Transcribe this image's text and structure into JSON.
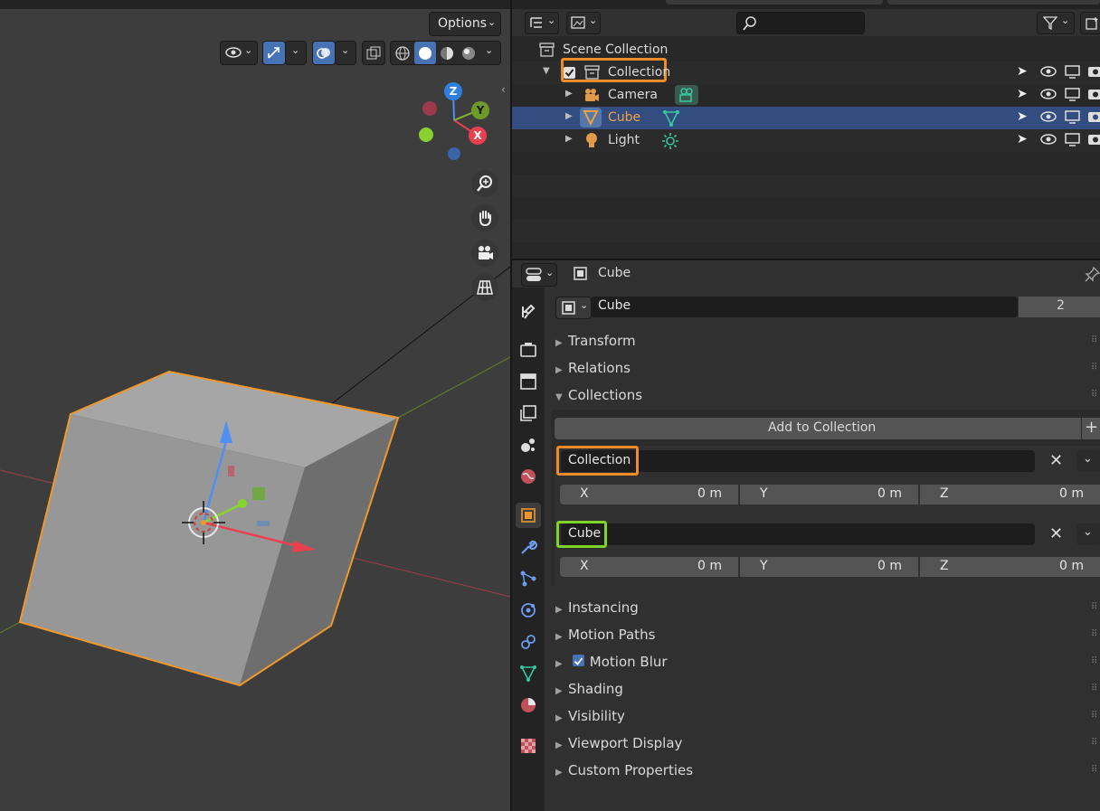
{
  "viewport": {
    "options_label": "Options",
    "gizmo": {
      "x": "X",
      "y": "Y",
      "z": "Z"
    }
  },
  "outliner": {
    "scene_collection": "Scene Collection",
    "rows": [
      {
        "label": "Collection"
      },
      {
        "label": "Camera"
      },
      {
        "label": "Cube"
      },
      {
        "label": "Light"
      }
    ]
  },
  "properties": {
    "header_title": "Cube",
    "object_name": "Cube",
    "user_count": "2",
    "panels": {
      "transform": "Transform",
      "relations": "Relations",
      "collections": "Collections",
      "instancing": "Instancing",
      "motion_paths": "Motion Paths",
      "motion_blur": "Motion Blur",
      "shading": "Shading",
      "visibility": "Visibility",
      "viewport_display": "Viewport Display",
      "custom_properties": "Custom Properties"
    },
    "add_to_collection": "Add to Collection",
    "collection_entries": [
      {
        "name": "Collection",
        "x_label": "X",
        "x": "0 m",
        "y_label": "Y",
        "y": "0 m",
        "z_label": "Z",
        "z": "0 m"
      },
      {
        "name": "Cube",
        "x_label": "X",
        "x": "0 m",
        "y_label": "Y",
        "y": "0 m",
        "z_label": "Z",
        "z": "0 m"
      }
    ]
  },
  "colors": {
    "highlight_orange": "#f08c28",
    "highlight_green": "#7fd42a",
    "selection_blue": "#334d80",
    "accent_blue": "#4772b3"
  }
}
